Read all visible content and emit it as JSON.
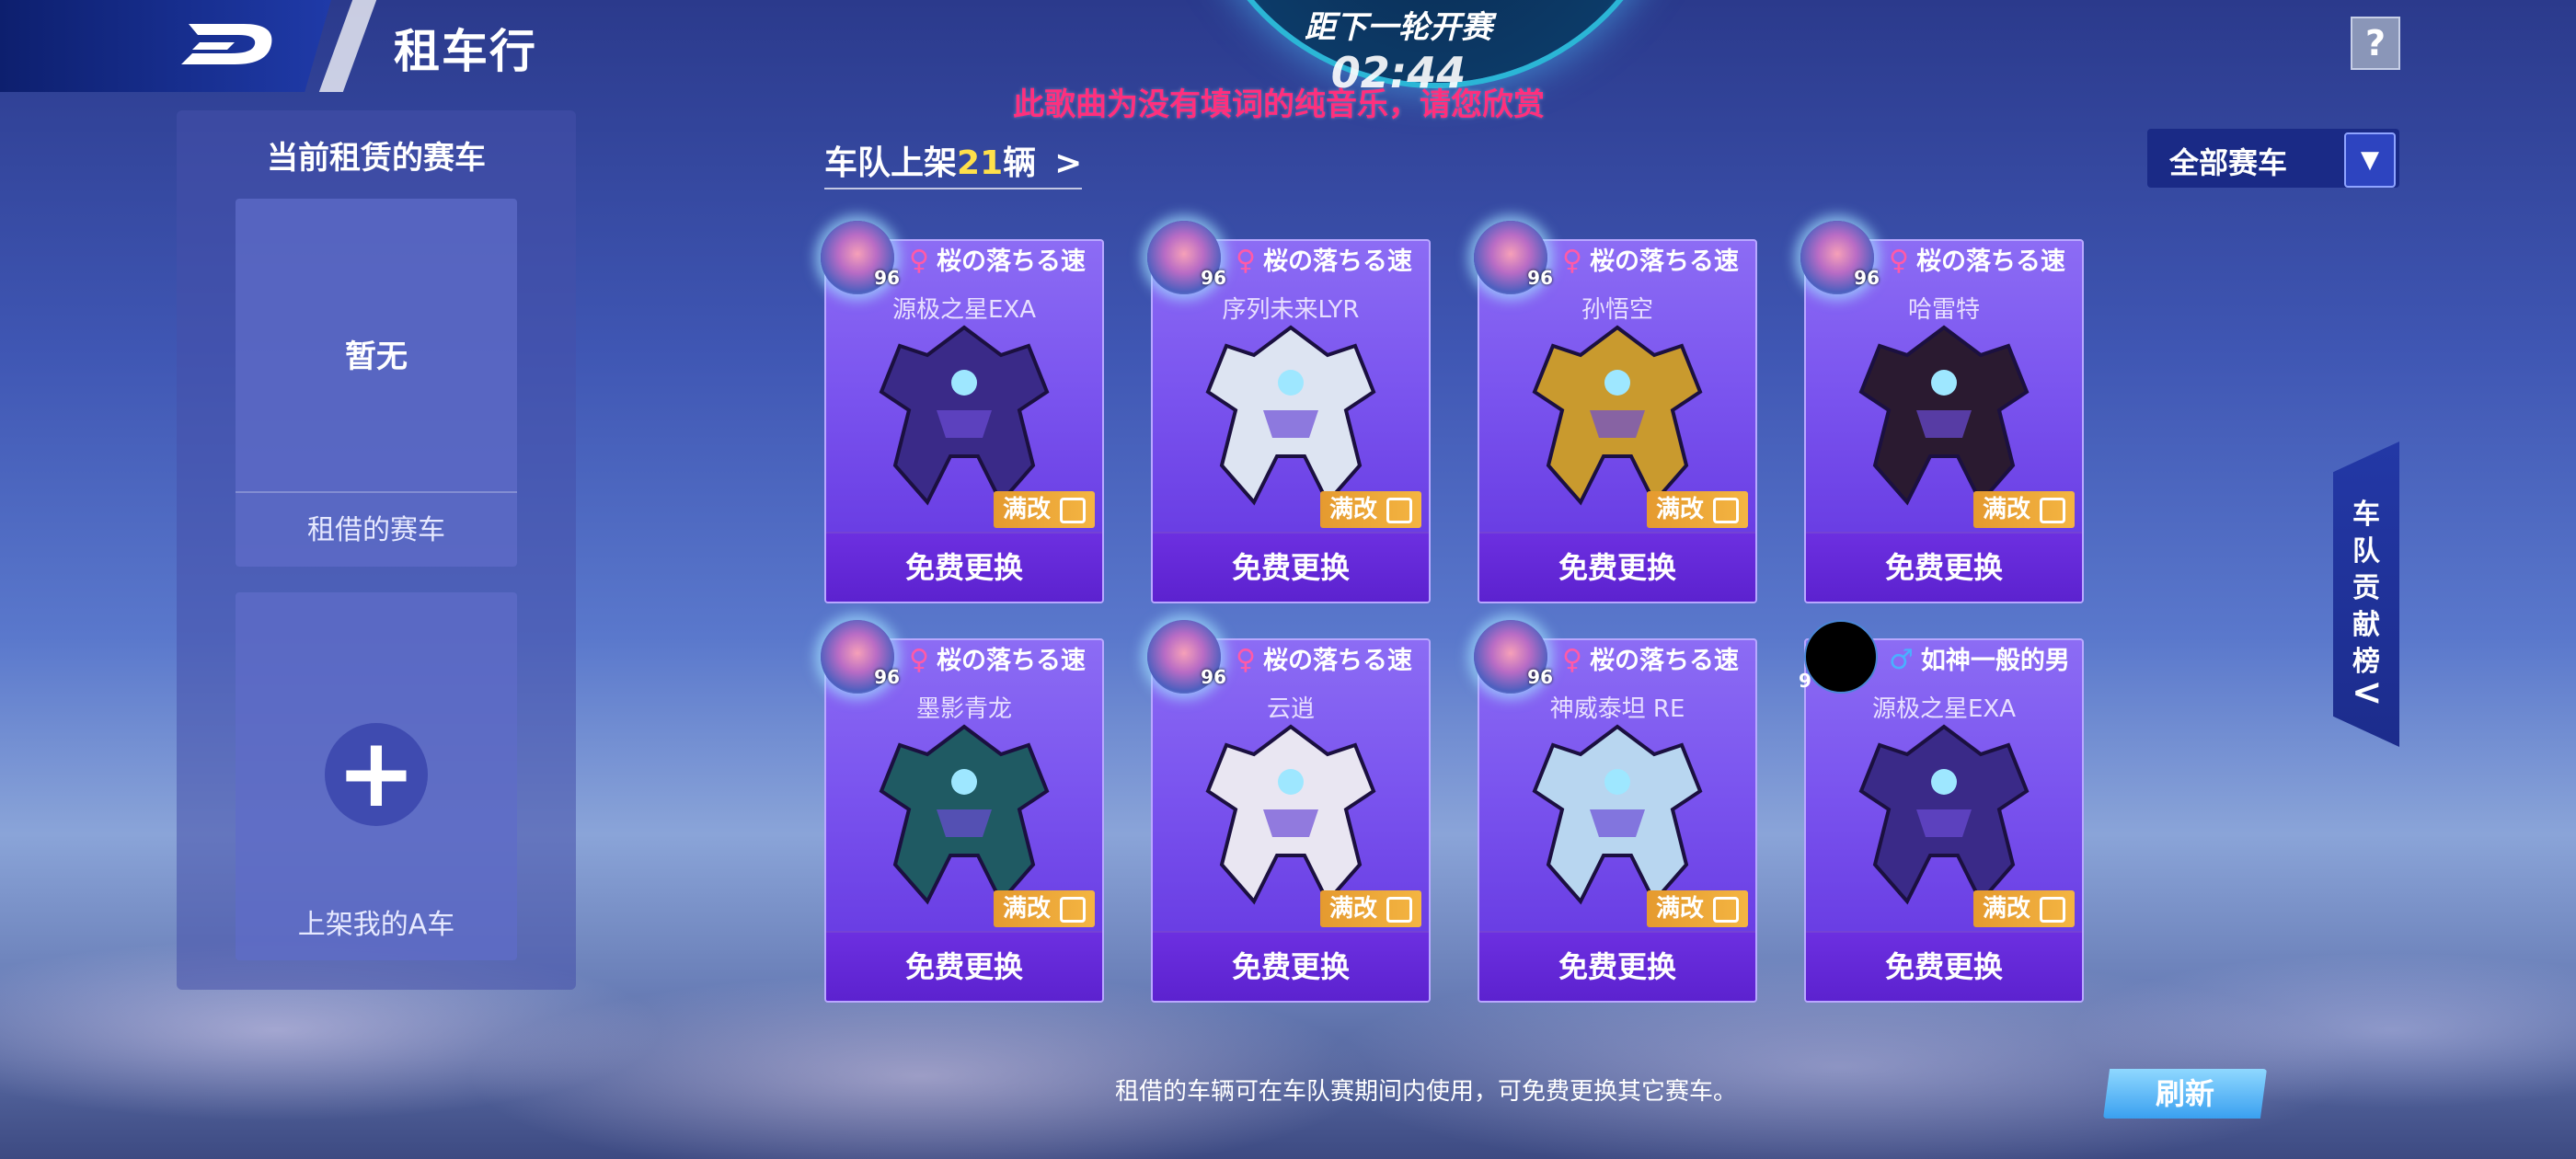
{
  "header": {
    "title": "租车行",
    "help_label": "?"
  },
  "timer": {
    "label": "距下一轮开赛",
    "value": "02:44"
  },
  "subtitle": "此歌曲为没有填词的纯音乐，请您欣赏",
  "left_panel": {
    "title": "当前租赁的赛车",
    "current_slot": {
      "empty_text": "暂无",
      "label": "租借的赛车"
    },
    "list_slot": {
      "label": "上架我的A车"
    }
  },
  "listing": {
    "prefix": "车队上架",
    "count": "21",
    "suffix": "辆",
    "arrow": ">"
  },
  "filter": {
    "value": "全部赛车",
    "icon": "chevron-down-icon"
  },
  "cards": [
    {
      "owner": "桜の落ちる速",
      "gender": "female",
      "gender_symbol": "♀",
      "level": "96",
      "car": "源极之星EXA",
      "tag": "满改",
      "action": "免费更换",
      "robot_color": "#3a2a88"
    },
    {
      "owner": "桜の落ちる速",
      "gender": "female",
      "gender_symbol": "♀",
      "level": "96",
      "car": "序列未来LYR",
      "tag": "满改",
      "action": "免费更换",
      "robot_color": "#dde4f2"
    },
    {
      "owner": "桜の落ちる速",
      "gender": "female",
      "gender_symbol": "♀",
      "level": "96",
      "car": "孙悟空",
      "tag": "满改",
      "action": "免费更换",
      "robot_color": "#c99a2e"
    },
    {
      "owner": "桜の落ちる速",
      "gender": "female",
      "gender_symbol": "♀",
      "level": "96",
      "car": "哈雷特",
      "tag": "满改",
      "action": "免费更换",
      "robot_color": "#2a1a30"
    },
    {
      "owner": "桜の落ちる速",
      "gender": "female",
      "gender_symbol": "♀",
      "level": "96",
      "car": "墨影青龙",
      "tag": "满改",
      "action": "免费更换",
      "robot_color": "#1f5a63"
    },
    {
      "owner": "桜の落ちる速",
      "gender": "female",
      "gender_symbol": "♀",
      "level": "96",
      "car": "云逍",
      "tag": "满改",
      "action": "免费更换",
      "robot_color": "#e9e6f2"
    },
    {
      "owner": "桜の落ちる速",
      "gender": "female",
      "gender_symbol": "♀",
      "level": "96",
      "car": "神威泰坦 RE",
      "tag": "满改",
      "action": "免费更换",
      "robot_color": "#b8d6f0"
    },
    {
      "owner": "如神一般的男",
      "gender": "male",
      "gender_symbol": "♂",
      "level": "9",
      "car": "源极之星EXA",
      "tag": "满改",
      "action": "免费更换",
      "robot_color": "#3a2a88"
    }
  ],
  "side_tab": {
    "label": "车队贡献榜",
    "chevron": "<"
  },
  "footer": {
    "note": "租借的车辆可在车队赛期间内使用，可免费更换其它赛车。",
    "refresh_label": "刷新"
  },
  "colors": {
    "accent_pink": "#ff2f7d",
    "count_yellow": "#ffe04a",
    "female_pink": "#ff5aa8",
    "male_blue": "#4ab0ff",
    "card_purple": "#7b55ef",
    "maxed_orange": "#e59a2f"
  }
}
